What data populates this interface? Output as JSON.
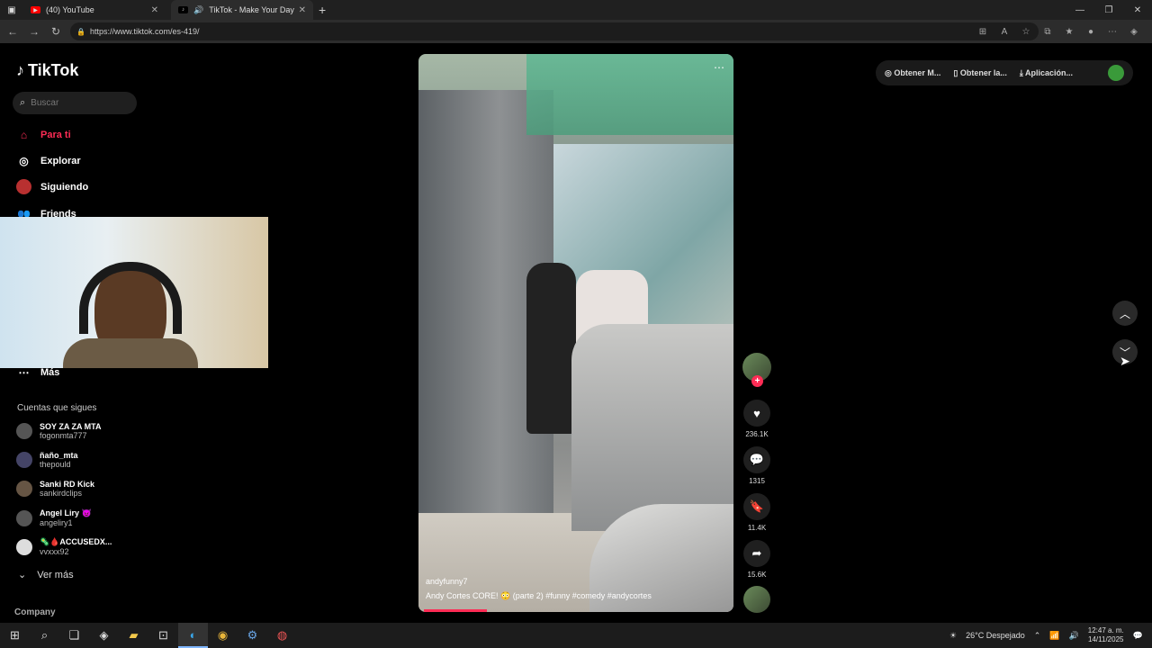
{
  "browser": {
    "tabs": [
      {
        "label": "(40) YouTube"
      },
      {
        "label": "TikTok - Make Your Day"
      }
    ],
    "url": "https://www.tiktok.com/es-419/"
  },
  "sidebar": {
    "logo": "TikTok",
    "search_placeholder": "Buscar",
    "nav": [
      {
        "label": "Para ti"
      },
      {
        "label": "Explorar"
      },
      {
        "label": "Siguiendo"
      },
      {
        "label": "Friends"
      },
      {
        "label": "Más"
      }
    ],
    "following_title": "Cuentas que sigues",
    "following": [
      {
        "name": "SOY ZA ZA MTA",
        "handle": "fogonmta777"
      },
      {
        "name": "ñaño_mta",
        "handle": "thepould"
      },
      {
        "name": "Sanki RD Kick",
        "handle": "sankirdclips"
      },
      {
        "name": "Angel Liry 😈",
        "handle": "angeliry1"
      },
      {
        "name": "🦠🩸ACCUSEDX...",
        "handle": "vvxxx92"
      }
    ],
    "see_more": "Ver más",
    "company": "Company"
  },
  "topbar": {
    "items": [
      "Obtener M...",
      "Obtener la...",
      "Aplicación..."
    ]
  },
  "video": {
    "username": "andyfunny7",
    "caption": "Andy Cortes CORE! 😳 (parte 2) #funny #comedy #andycortes",
    "likes": "236.1K",
    "comments": "1315",
    "saves": "11.4K",
    "shares": "15.6K"
  },
  "taskbar": {
    "weather": "26°C Despejado",
    "time": "12:47 a. m.",
    "date": "14/11/2025"
  }
}
